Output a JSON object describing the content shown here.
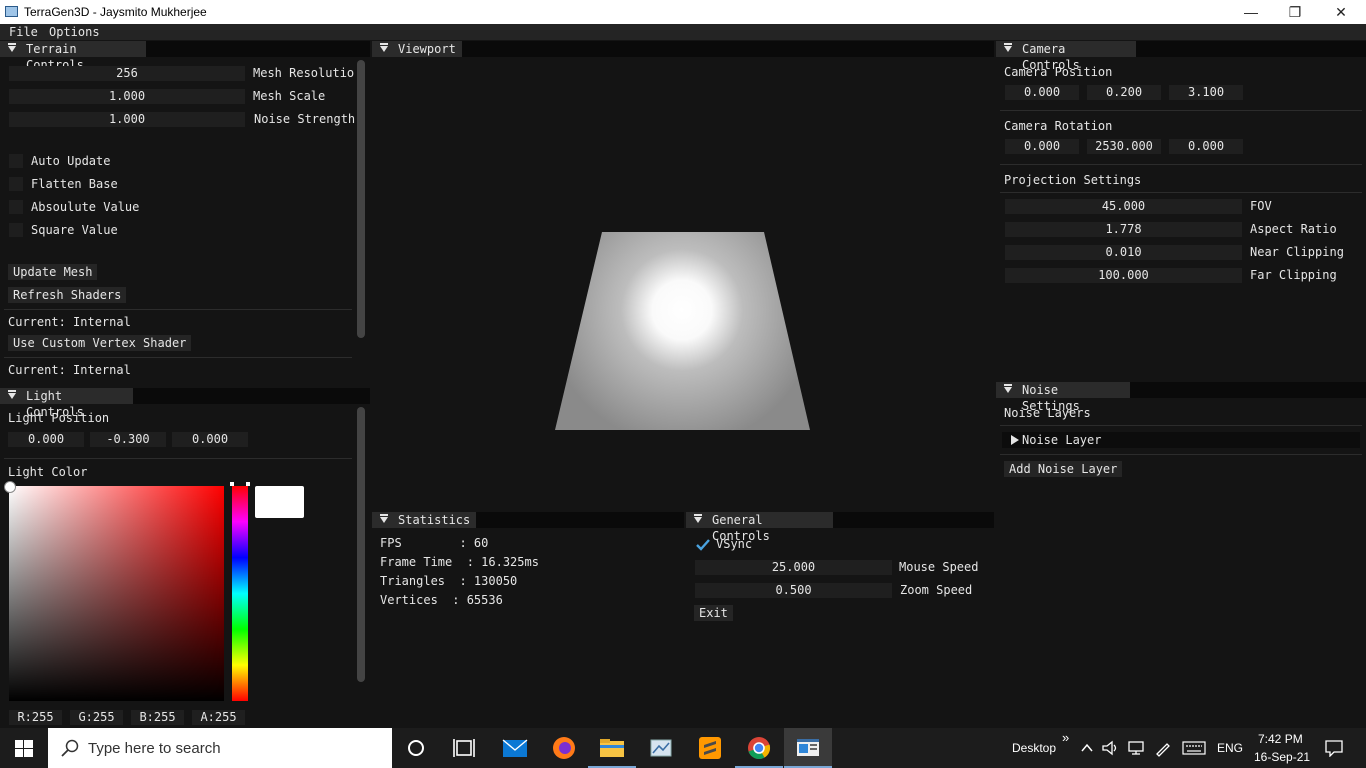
{
  "window": {
    "title": "TerraGen3D - Jaysmito Mukherjee",
    "min": "—",
    "max": "❐",
    "close": "✕"
  },
  "menu": {
    "file": "File",
    "options": "Options"
  },
  "terrain": {
    "title": "Terrain Controls",
    "fields": [
      {
        "value": "256",
        "label": "Mesh Resolutio"
      },
      {
        "value": "1.000",
        "label": "Mesh Scale"
      },
      {
        "value": "1.000",
        "label": "Noise Strength"
      }
    ],
    "checkboxes": [
      "Auto Update",
      "Flatten Base",
      "Absoulute Value",
      "Square Value"
    ],
    "update_mesh": "Update Mesh",
    "refresh_shaders": "Refresh Shaders",
    "current1": "Current: Internal",
    "use_custom_vertex": "Use Custom Vertex Shader",
    "current2": "Current: Internal"
  },
  "light": {
    "title": "Light Controls",
    "position_label": "Light Position",
    "position": [
      "0.000",
      "-0.300",
      "0.000"
    ],
    "color_label": "Light Color",
    "channels": [
      "R:255",
      "G:255",
      "B:255",
      "A:255"
    ],
    "color": "#ffffff"
  },
  "viewport": {
    "title": "Viewport"
  },
  "stats": {
    "title": "Statistics",
    "lines": [
      "FPS        : 60",
      "Frame Time  : 16.325ms",
      "Triangles  : 130050",
      "Vertices  : 65536"
    ]
  },
  "general": {
    "title": "General Controls",
    "vsync": "VSync",
    "mouse_speed": {
      "value": "25.000",
      "label": "Mouse Speed"
    },
    "zoom_speed": {
      "value": "0.500",
      "label": "Zoom Speed"
    },
    "exit": "Exit"
  },
  "camera": {
    "title": "Camera Controls",
    "position_label": "Camera Position",
    "position": [
      "0.000",
      "0.200",
      "3.100"
    ],
    "rotation_label": "Camera Rotation",
    "rotation": [
      "0.000",
      "2530.000",
      "0.000"
    ],
    "projection_label": "Projection Settings",
    "projection": [
      {
        "value": "45.000",
        "label": "FOV"
      },
      {
        "value": "1.778",
        "label": "Aspect Ratio"
      },
      {
        "value": "0.010",
        "label": "Near Clipping"
      },
      {
        "value": "100.000",
        "label": "Far Clipping"
      }
    ]
  },
  "noise": {
    "title": "Noise Settings",
    "layers_label": "Noise Layers",
    "layer": "Noise Layer",
    "add_layer": "Add Noise Layer"
  },
  "taskbar": {
    "search_placeholder": "Type here to search",
    "desktop": "Desktop",
    "chevron": "»",
    "lang": "ENG",
    "time": "7:42 PM",
    "date": "16-Sep-21"
  }
}
